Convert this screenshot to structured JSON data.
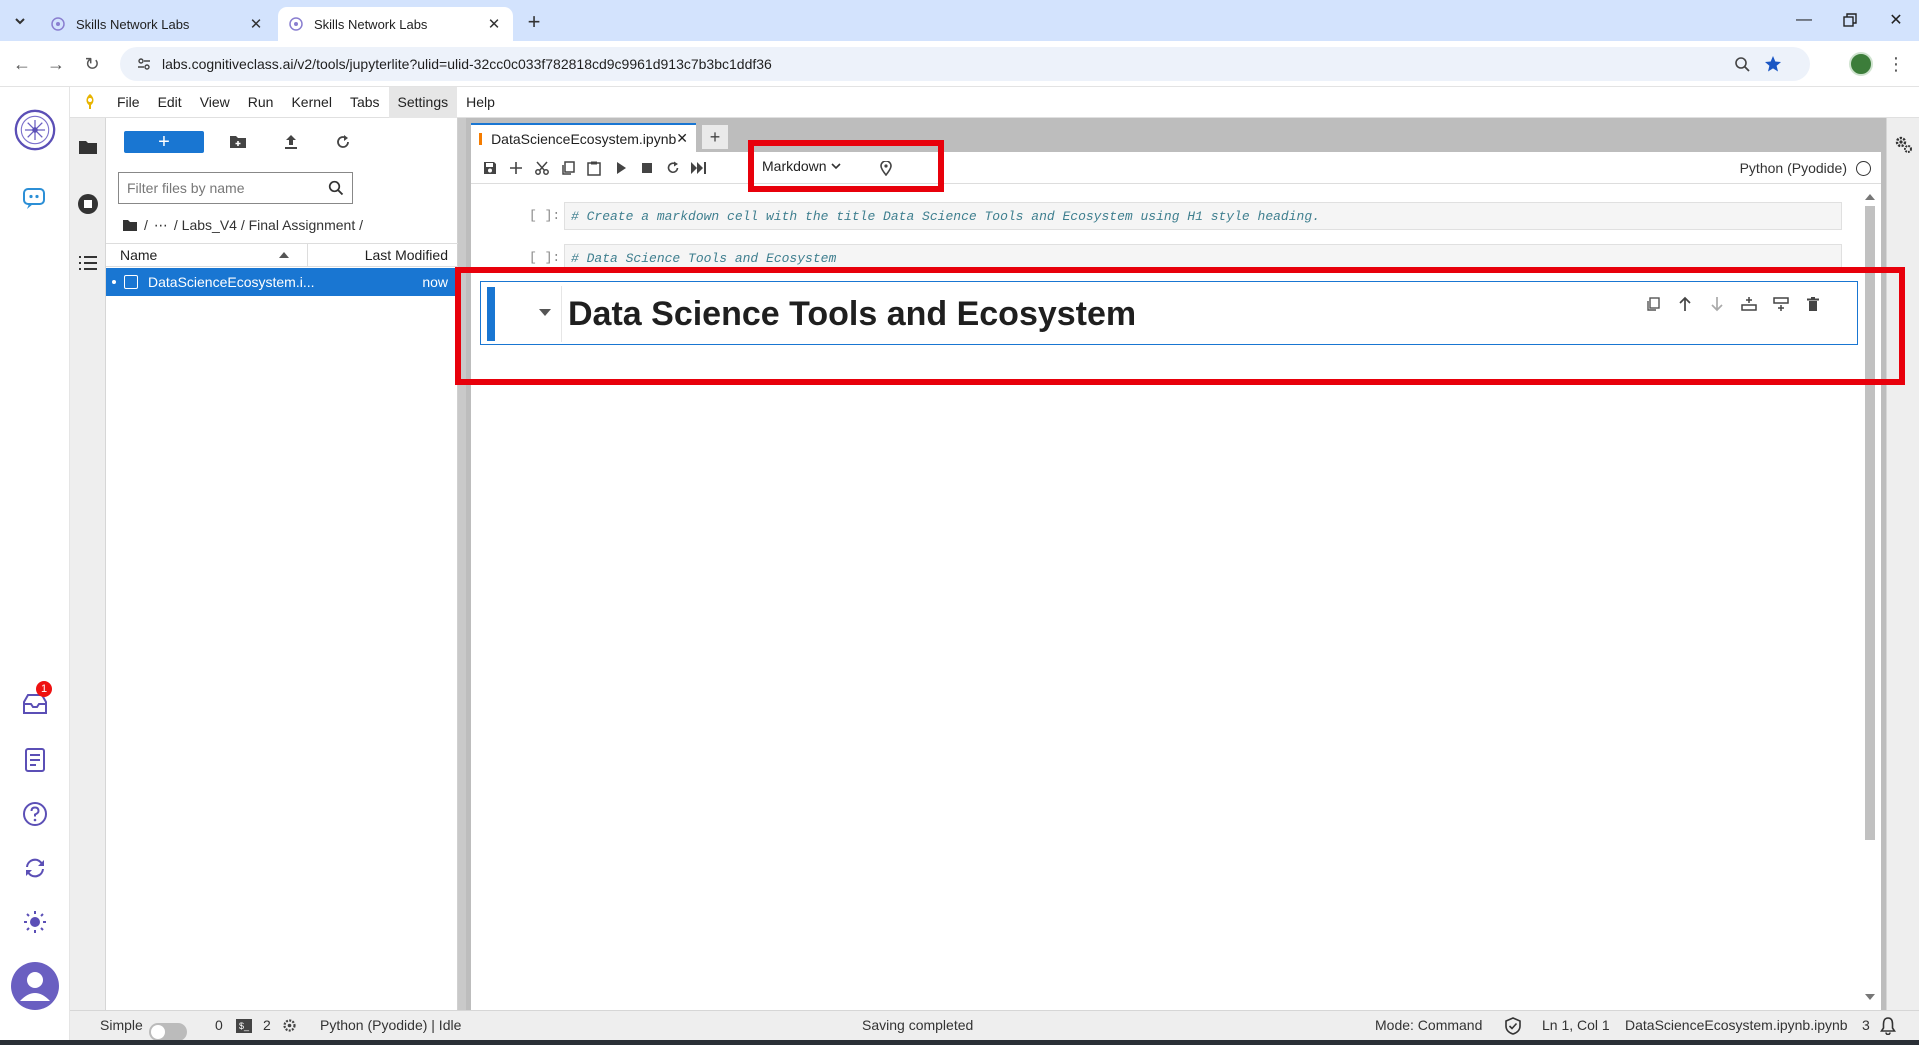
{
  "browser": {
    "tabs": [
      {
        "title": "Skills Network Labs",
        "active": false
      },
      {
        "title": "Skills Network Labs",
        "active": true
      }
    ],
    "url": "labs.cognitiveclass.ai/v2/tools/jupyterlite?ulid=ulid-32cc0c033f782818cd9c9961d913c7b3bc1ddf36"
  },
  "rail": {
    "notification_count": "1"
  },
  "menu": [
    "File",
    "Edit",
    "View",
    "Run",
    "Kernel",
    "Tabs",
    "Settings",
    "Help"
  ],
  "filebrowser": {
    "new_label": "+",
    "filter_placeholder": "Filter files by name",
    "breadcrumb": [
      "/",
      "⋯",
      "/ Labs_V4 / Final Assignment /"
    ],
    "col_name": "Name",
    "col_modified": "Last Modified",
    "files": [
      {
        "name": "DataScienceEcosystem.i...",
        "modified": "now"
      }
    ]
  },
  "notebook": {
    "tab_title": "DataScienceEcosystem.ipynb",
    "cell_type": "Markdown",
    "kernel": "Python (Pyodide)",
    "cells": [
      {
        "prompt": "[ ]:",
        "source": "# Create a markdown cell with the title Data Science Tools and Ecosystem using H1 style heading."
      },
      {
        "prompt": "[ ]:",
        "source": "# Data Science Tools and Ecosystem"
      }
    ],
    "markdown_heading": "Data Science Tools and Ecosystem"
  },
  "status": {
    "mode_label": "Simple",
    "terminals": "0",
    "kernels": "2",
    "kernel_status": "Python (Pyodide) | Idle",
    "message": "Saving completed",
    "mode": "Mode: Command",
    "position": "Ln 1, Col 1",
    "file": "DataScienceEcosystem.ipynb.ipynb",
    "count": "3"
  },
  "colors": {
    "accent": "#1976d2",
    "highlight": "#e8000b",
    "tabstrip": "#d3e3fd"
  }
}
